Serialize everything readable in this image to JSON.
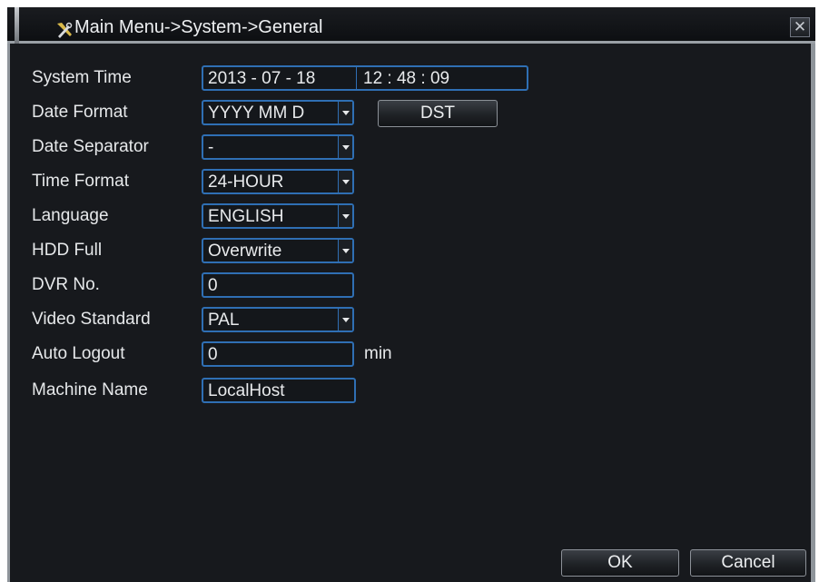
{
  "window": {
    "title": "Main Menu->System->General",
    "close_glyph": "✕",
    "icon": "tools-icon"
  },
  "fields": {
    "system_time": {
      "label": "System Time",
      "date": "2013 - 07 - 18",
      "time": "12 : 48 : 09"
    },
    "date_format": {
      "label": "Date Format",
      "value": "YYYY MM D"
    },
    "date_separator": {
      "label": "Date Separator",
      "value": "-"
    },
    "time_format": {
      "label": "Time Format",
      "value": "24-HOUR"
    },
    "language": {
      "label": "Language",
      "value": "ENGLISH"
    },
    "hdd_full": {
      "label": "HDD Full",
      "value": "Overwrite"
    },
    "dvr_no": {
      "label": "DVR No.",
      "value": "0"
    },
    "video_standard": {
      "label": "Video Standard",
      "value": "PAL"
    },
    "auto_logout": {
      "label": "Auto Logout",
      "value": "0",
      "unit": "min"
    },
    "machine_name": {
      "label": "Machine Name",
      "value": "LocalHost"
    }
  },
  "buttons": {
    "dst": "DST",
    "ok": "OK",
    "cancel": "Cancel"
  },
  "colors": {
    "background": "#17191d",
    "field_border": "#2f6fb4",
    "text": "#e6e8ea"
  }
}
